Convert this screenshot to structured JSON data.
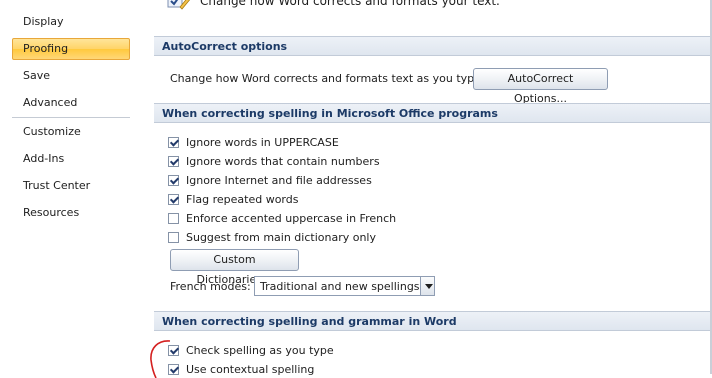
{
  "sidebar": {
    "items": [
      {
        "label": "Display"
      },
      {
        "label": "Proofing"
      },
      {
        "label": "Save"
      },
      {
        "label": "Advanced"
      },
      {
        "label": "Customize"
      },
      {
        "label": "Add-Ins"
      },
      {
        "label": "Trust Center"
      },
      {
        "label": "Resources"
      }
    ],
    "active": "Proofing"
  },
  "header": {
    "description": "Change how Word corrects and formats your text."
  },
  "autocorrect": {
    "title": "AutoCorrect options",
    "text": "Change how Word corrects and formats text as you type:",
    "button_label": "AutoCorrect Options..."
  },
  "office_spelling": {
    "title": "When correcting spelling in Microsoft Office programs",
    "options": [
      {
        "label": "Ignore words in UPPERCASE",
        "checked": true
      },
      {
        "label": "Ignore words that contain numbers",
        "checked": true
      },
      {
        "label": "Ignore Internet and file addresses",
        "checked": true
      },
      {
        "label": "Flag repeated words",
        "checked": true
      },
      {
        "label": "Enforce accented uppercase in French",
        "checked": false
      },
      {
        "label": "Suggest from main dictionary only",
        "checked": false
      }
    ],
    "custom_dictionaries_label": "Custom Dictionaries...",
    "french_modes_label": "French modes:",
    "french_modes_value": "Traditional and new spellings"
  },
  "word_spelling": {
    "title": "When correcting spelling and grammar in Word",
    "options": [
      {
        "label": "Check spelling as you type",
        "checked": true
      },
      {
        "label": "Use contextual spelling",
        "checked": true
      }
    ]
  },
  "colors": {
    "header_text": "#1c3a66",
    "active_nav": "#ffd468",
    "annotation_red": "#d42020"
  }
}
